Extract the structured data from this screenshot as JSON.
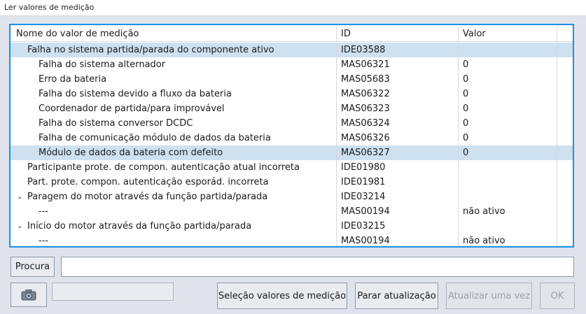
{
  "window": {
    "title": "Ler valores de medição"
  },
  "table": {
    "headers": {
      "name": "Nome do valor de medição",
      "id": "ID",
      "value": "Valor"
    },
    "rows": [
      {
        "name": "Falha no sistema partida/parada do componente ativo",
        "id": "IDE03588",
        "value": ""
      },
      {
        "name": "Falha do sistema alternador",
        "id": "MAS06321",
        "value": "0"
      },
      {
        "name": "Erro da bateria",
        "id": "MAS05683",
        "value": "0"
      },
      {
        "name": "Falha do sistema devido a fluxo da bateria",
        "id": "MAS06322",
        "value": "0"
      },
      {
        "name": "Coordenador de partida/para improvável",
        "id": "MAS06323",
        "value": "0"
      },
      {
        "name": "Falha do sistema conversor DCDC",
        "id": "MAS06324",
        "value": "0"
      },
      {
        "name": "Falha de comunicação módulo de dados da bateria",
        "id": "MAS06326",
        "value": "0"
      },
      {
        "name": "Módulo de dados da bateria com defeito",
        "id": "MAS06327",
        "value": "0"
      },
      {
        "name": "Participante prote. de compon. autenticação atual incorreta",
        "id": "IDE01980",
        "value": ""
      },
      {
        "name": "Part. prote. compon. autenticação esporád. incorreta",
        "id": "IDE01981",
        "value": ""
      },
      {
        "name": "Paragem do motor através da função partida/parada",
        "id": "IDE03214",
        "value": ""
      },
      {
        "name": "---",
        "id": "MAS00194",
        "value": "não ativo"
      },
      {
        "name": "Início do motor através da função partida/parada",
        "id": "IDE03215",
        "value": ""
      },
      {
        "name": "---",
        "id": "MAS00194",
        "value": "não ativo"
      }
    ]
  },
  "search": {
    "button_label": "Procura",
    "value": ""
  },
  "toolbar": {
    "select_values_label": "Seleção valores de medição",
    "stop_update_label": "Parar atualização",
    "update_once_label": "Atualizar uma vez",
    "ok_label": "OK"
  },
  "icons": {
    "camera": "camera-icon",
    "expand": "chevron-down-icon"
  },
  "colors": {
    "frame_border": "#1f8fe6",
    "row_highlight": "#cde1f1"
  }
}
